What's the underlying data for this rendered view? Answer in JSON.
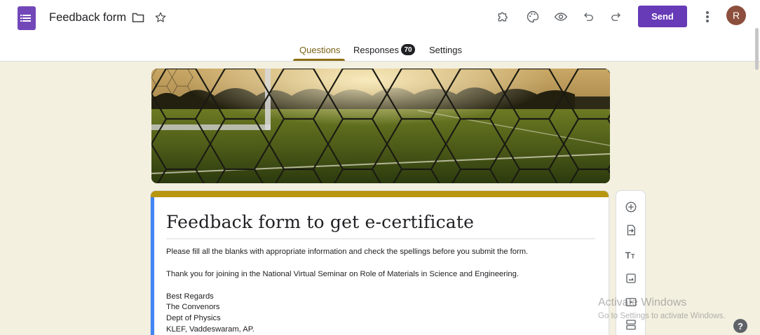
{
  "header": {
    "doc_title": "Feedback form",
    "send_label": "Send",
    "avatar_initial": "R",
    "icons": [
      "forms-app-icon",
      "folder-icon",
      "star-icon",
      "addon-puzzle-icon",
      "palette-icon",
      "preview-eye-icon",
      "undo-icon",
      "redo-icon",
      "more-vert-icon"
    ],
    "accent_color": "#673ab7"
  },
  "tabs": {
    "questions": "Questions",
    "responses": "Responses",
    "responses_count": "70",
    "settings": "Settings",
    "active_color": "#8b6e13"
  },
  "form": {
    "title": "Feedback form to get e-certificate",
    "description_lines": [
      "Please fill all the blanks with appropriate information and check the spellings before you submit the form.",
      "Thank you for joining in the National Virtual Seminar on Role of Materials in Science and Engineering.",
      "Best Regards",
      "The Convenors",
      "Dept of Physics",
      "KLEF, Vaddeswaram, AP."
    ],
    "header_color": "#b8960f",
    "background_color": "#f3f0e0"
  },
  "sidebar_tools": [
    "add-question-icon",
    "import-questions-icon",
    "add-title-icon",
    "add-image-icon",
    "add-video-icon",
    "add-section-icon"
  ],
  "watermark": {
    "line1": "Activate Windows",
    "line2": "Go to Settings to activate Windows."
  },
  "help_label": "?"
}
